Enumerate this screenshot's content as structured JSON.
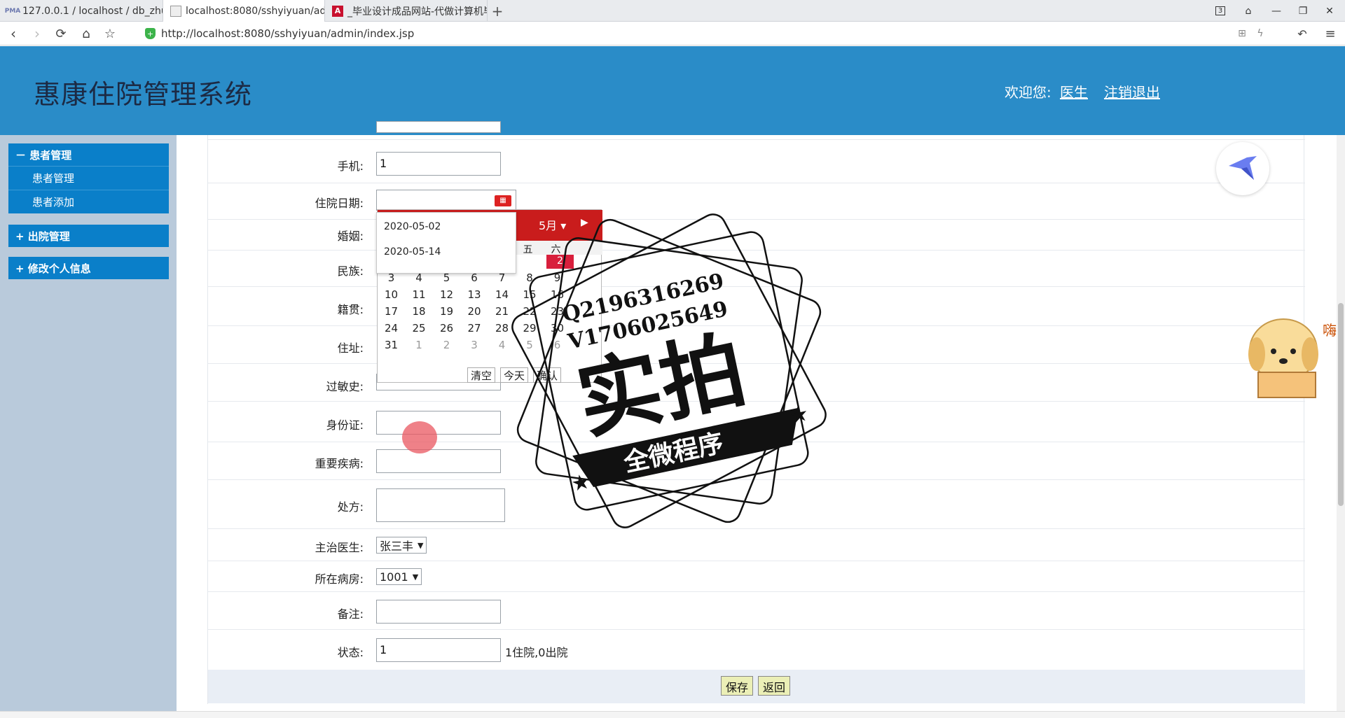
{
  "browser": {
    "tabs": [
      {
        "label": "127.0.0.1 / localhost / db_zhuy",
        "favicon": "PMA"
      },
      {
        "label": "localhost:8080/sshyiyuan/adm",
        "favicon": "img"
      },
      {
        "label": "_毕业设计成品网站-代做计算机毕",
        "favicon": "A"
      }
    ],
    "tab_count": "3",
    "url": "http://localhost:8080/sshyiyuan/admin/index.jsp"
  },
  "header": {
    "title": "惠康住院管理系统",
    "welcome": "欢迎您:",
    "user": "医生",
    "logout": "注销退出"
  },
  "sidebar": {
    "groups": [
      {
        "label": "－ 患者管理",
        "items": [
          "患者管理",
          "患者添加"
        ]
      },
      {
        "label": "+ 出院管理"
      },
      {
        "label": "+ 修改个人信息"
      }
    ]
  },
  "form": {
    "fields": [
      {
        "label": "手机:",
        "value": "1"
      },
      {
        "label": "住院日期:",
        "value": ""
      },
      {
        "label": "婚姻:",
        "value": ""
      },
      {
        "label": "民族:",
        "value": ""
      },
      {
        "label": "籍贯:",
        "value": ""
      },
      {
        "label": "住址:",
        "value": ""
      },
      {
        "label": "过敏史:",
        "value": ""
      },
      {
        "label": "身份证:",
        "value": ""
      },
      {
        "label": "重要疾病:",
        "value": ""
      },
      {
        "label": "处方:",
        "value": ""
      },
      {
        "label": "主治医生:",
        "value": "张三丰"
      },
      {
        "label": "所在病房:",
        "value": "1001"
      },
      {
        "label": "备注:",
        "value": ""
      },
      {
        "label": "状态:",
        "value": "1"
      }
    ],
    "status_hint": "1住院,0出院",
    "save": "保存",
    "back": "返回"
  },
  "datepicker": {
    "month": "5月",
    "weekdays_visible": [
      "五",
      "六"
    ],
    "first_row_visible": [
      "2"
    ],
    "weeks": [
      [
        "3",
        "4",
        "5",
        "6",
        "7",
        "8",
        "9"
      ],
      [
        "10",
        "11",
        "12",
        "13",
        "14",
        "15",
        "16"
      ],
      [
        "17",
        "18",
        "19",
        "20",
        "21",
        "22",
        "23"
      ],
      [
        "24",
        "25",
        "26",
        "27",
        "28",
        "29",
        "30"
      ],
      [
        "31",
        "1",
        "2",
        "3",
        "4",
        "5",
        "6"
      ]
    ],
    "clear": "清空",
    "today": "今天",
    "confirm": "确认",
    "suggestions": [
      "2020-05-02",
      "2020-05-14"
    ]
  },
  "overlay": {
    "qq": "Q2196316269",
    "wechat": "V1706025649",
    "stamp_main": "实拍",
    "stamp_banner": "全微程序",
    "mascot_text": "嗨"
  },
  "colors": {
    "header": "#2a8cc8",
    "menu": "#0a7fc9",
    "sidebar_bg": "#b9cadb",
    "picker_red": "#c91c1c"
  }
}
